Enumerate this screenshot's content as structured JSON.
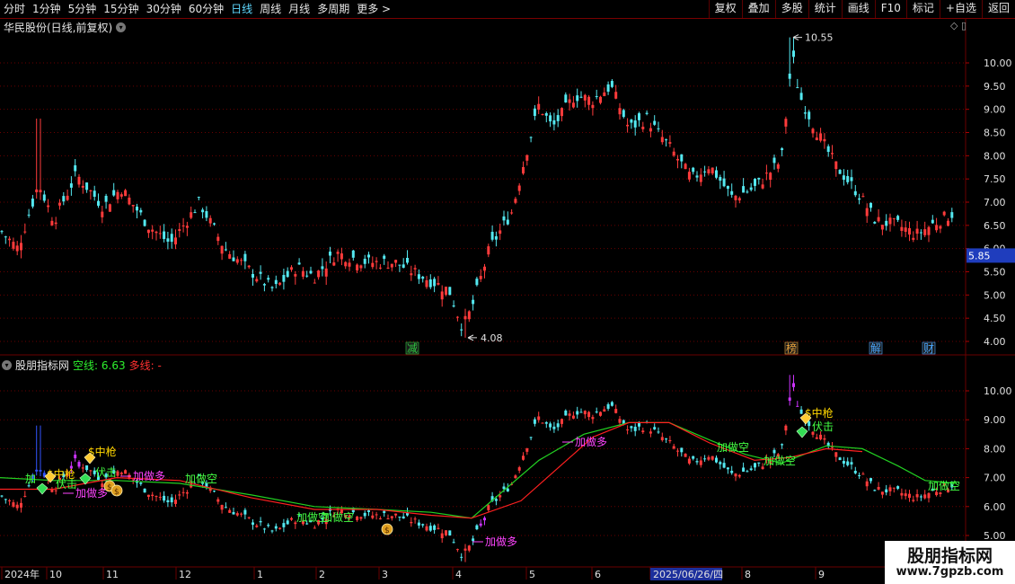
{
  "toolbar": {
    "periods": [
      "分时",
      "1分钟",
      "5分钟",
      "15分钟",
      "30分钟",
      "60分钟",
      "日线",
      "周线",
      "月线",
      "多周期",
      "更多 >"
    ],
    "active_period": "日线",
    "buttons": [
      "复权",
      "叠加",
      "多股",
      "统计",
      "画线",
      "F10",
      "标记",
      "+自选",
      "返回"
    ]
  },
  "main_chart": {
    "title": "华民股份(日线,前复权)",
    "price_axis": [
      "10.00",
      "9.50",
      "9.00",
      "8.50",
      "8.00",
      "7.50",
      "7.00",
      "6.50",
      "6.00",
      "5.50",
      "5.00",
      "4.50",
      "4.00"
    ],
    "current_price_tag": "5.85",
    "high_annotation": "10.55",
    "low_annotation": "4.08",
    "event_tags": [
      {
        "label": "减",
        "color": "#2ecc40"
      },
      {
        "label": "榜",
        "color": "#e8a33c"
      },
      {
        "label": "解",
        "color": "#4aa8ff"
      },
      {
        "label": "财",
        "color": "#4aa8ff"
      }
    ]
  },
  "indicator": {
    "name": "股朋指标网",
    "kong_label": "空线:",
    "kong_value": "6.63",
    "duo_label": "多线:",
    "duo_value": "-",
    "axis": [
      "10.00",
      "9.00",
      "8.00",
      "7.00",
      "6.00",
      "5.00"
    ],
    "signals": [
      "加做多",
      "加做空",
      "$中枪",
      "伏击"
    ],
    "signal_list": [
      "加",
      "$中枪",
      "伏击",
      "加做多",
      "$中枪",
      "伏击",
      "加做多",
      "加做空",
      "加做空",
      "加做空",
      "加做多",
      "加做多",
      "加做空",
      "加做空",
      "$中枪",
      "伏击",
      "加做空"
    ]
  },
  "x_axis": [
    "2024年",
    "10",
    "11",
    "12",
    "1",
    "2",
    "3",
    "4",
    "5",
    "6",
    "2025/06/26/四",
    "8",
    "9"
  ],
  "colors": {
    "up": "#ff3b3b",
    "down": "#54e8f0",
    "kong_line": "#22d022",
    "duo_line": "#ff2020",
    "grid": "#6a0000",
    "signal_long": "#ff44ff",
    "signal_short": "#44ff44",
    "signal_gold": "#ffd700"
  },
  "watermark": {
    "title": "股朋指标网",
    "url": "www.7gpzb.com"
  }
}
